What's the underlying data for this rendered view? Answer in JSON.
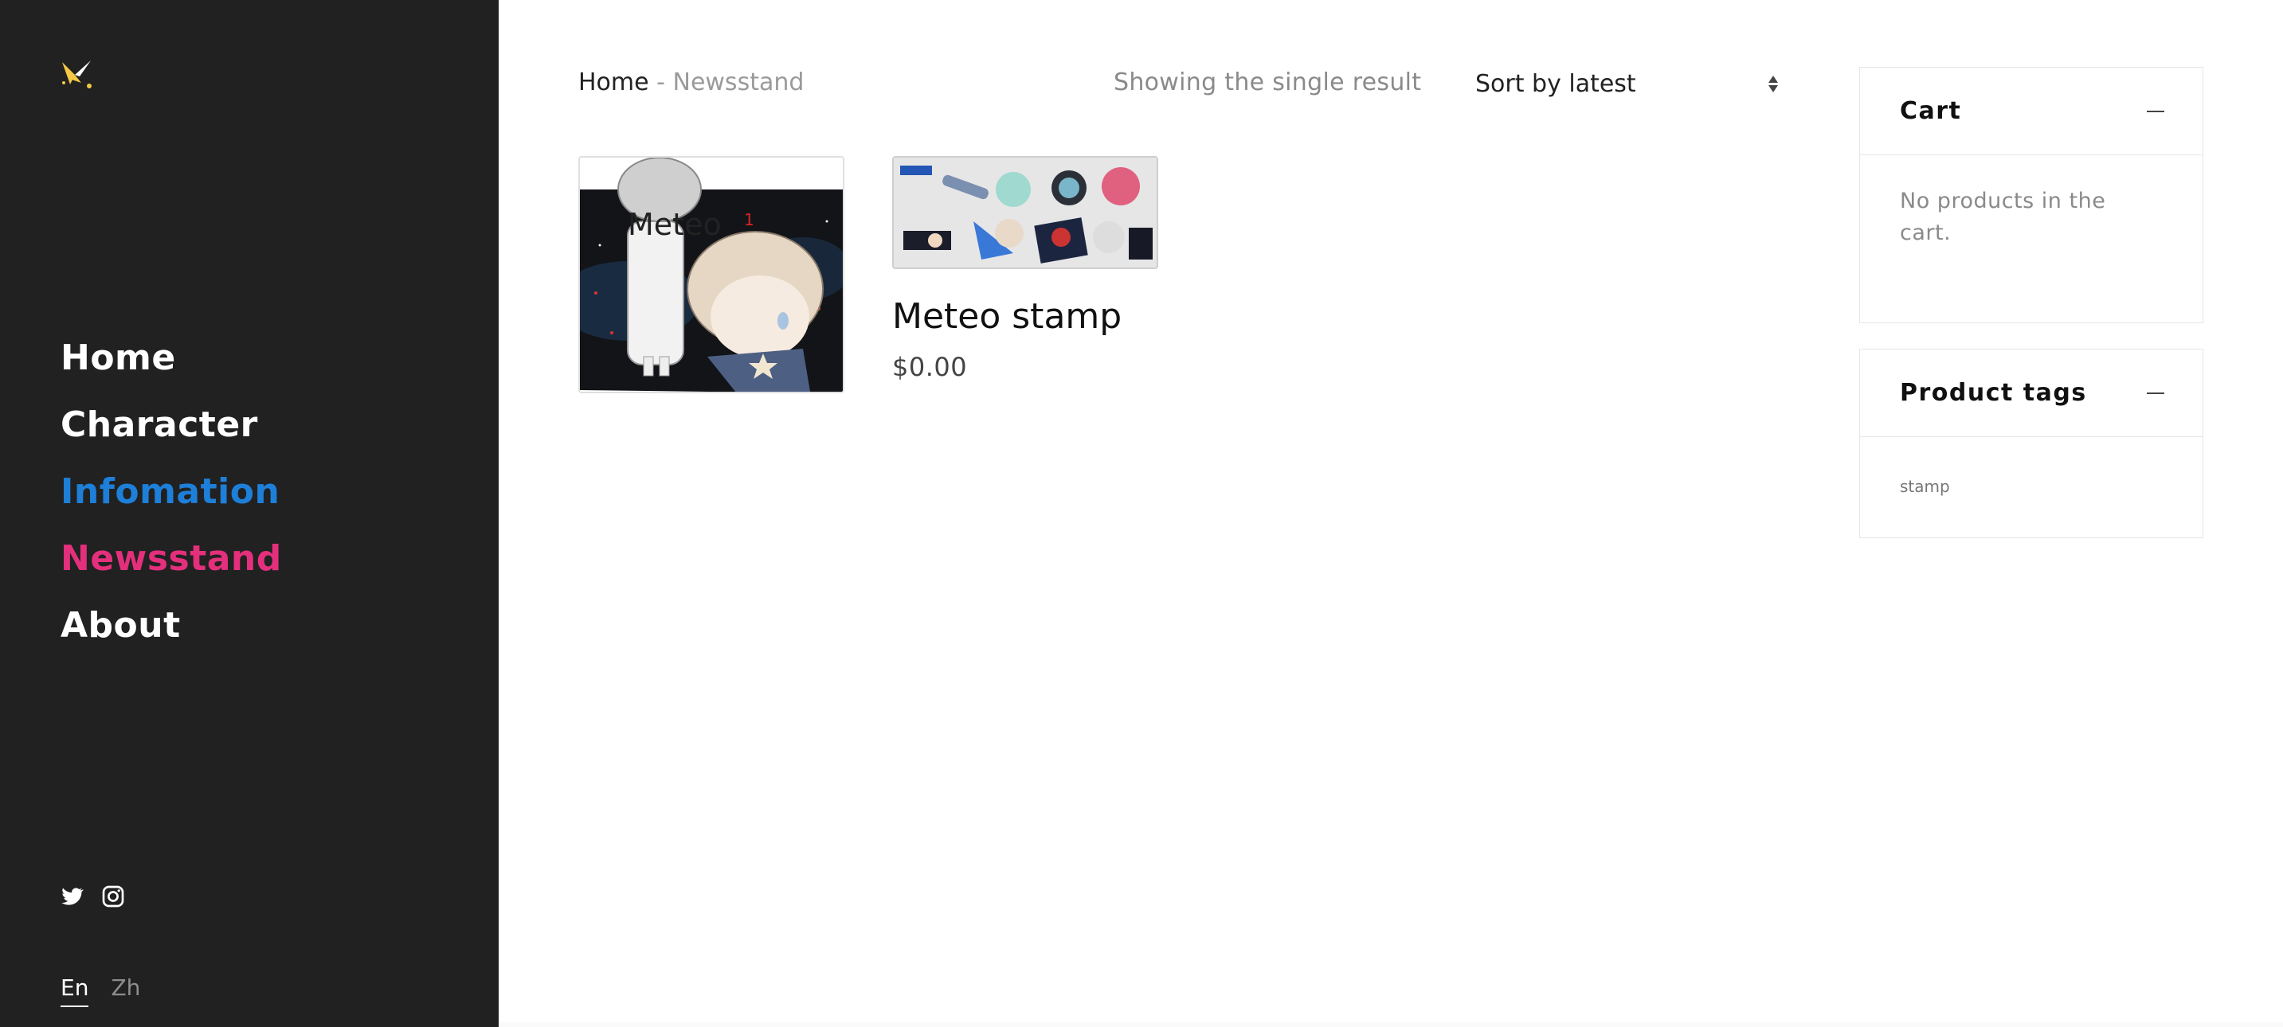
{
  "nav": {
    "items": [
      {
        "label": "Home",
        "color": "#ffffff"
      },
      {
        "label": "Character",
        "color": "#ffffff"
      },
      {
        "label": "Infomation",
        "color": "#1e7fd9"
      },
      {
        "label": "Newsstand",
        "color": "#e4307c"
      },
      {
        "label": "About",
        "color": "#ffffff"
      }
    ]
  },
  "social": {
    "icons": [
      "twitter-icon",
      "instagram-icon"
    ]
  },
  "language": {
    "current": "En",
    "other": "Zh"
  },
  "breadcrumb": {
    "home": "Home",
    "separator": " - ",
    "current": "Newsstand"
  },
  "shop": {
    "result_count": "Showing the single result",
    "sort_label": "Sort by latest"
  },
  "product": {
    "title": "Meteo stamp",
    "price": "$0.00",
    "image_text": "Meteo",
    "image_mark": "1"
  },
  "widgets": {
    "cart": {
      "title": "Cart",
      "empty_text": "No products in the cart."
    },
    "tags": {
      "title": "Product tags",
      "items": [
        "stamp"
      ]
    }
  },
  "colors": {
    "sidebar_bg": "#212121",
    "accent_blue": "#1e7fd9",
    "accent_pink": "#e4307c",
    "logo_gold": "#f3c844"
  }
}
